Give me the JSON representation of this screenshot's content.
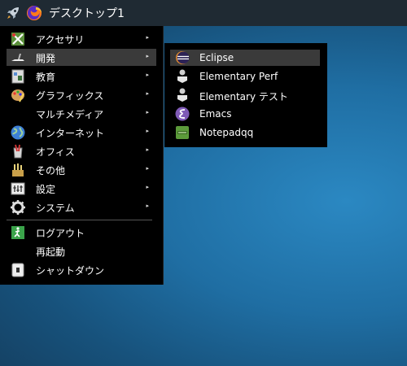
{
  "taskbar": {
    "title": "デスクトップ1",
    "icons": [
      "rocket-icon",
      "firefox-icon"
    ]
  },
  "menu": {
    "items": [
      {
        "label": "アクセサリ",
        "icon": "accessories-icon",
        "submenu": true
      },
      {
        "label": "開発",
        "icon": "development-icon",
        "submenu": true,
        "active": true
      },
      {
        "label": "教育",
        "icon": "education-icon",
        "submenu": true
      },
      {
        "label": "グラフィックス",
        "icon": "graphics-icon",
        "submenu": true
      },
      {
        "label": "マルチメディア",
        "icon": "",
        "submenu": true
      },
      {
        "label": "インターネット",
        "icon": "internet-icon",
        "submenu": true
      },
      {
        "label": "オフィス",
        "icon": "office-icon",
        "submenu": true
      },
      {
        "label": "その他",
        "icon": "other-icon",
        "submenu": true
      },
      {
        "label": "設定",
        "icon": "settings-icon",
        "submenu": true
      },
      {
        "label": "システム",
        "icon": "system-gear-icon",
        "submenu": true
      },
      {
        "label": "ログアウト",
        "icon": "logout-icon",
        "submenu": false
      },
      {
        "label": "再起動",
        "icon": "",
        "submenu": false
      },
      {
        "label": "シャットダウン",
        "icon": "shutdown-icon",
        "submenu": false
      }
    ],
    "arrow": "▸"
  },
  "submenu": {
    "items": [
      {
        "label": "Eclipse",
        "icon": "eclipse-icon",
        "active": true
      },
      {
        "label": "Elementary Perf",
        "icon": "elementary-perf-icon"
      },
      {
        "label": "Elementary テスト",
        "icon": "elementary-test-icon"
      },
      {
        "label": "Emacs",
        "icon": "emacs-icon"
      },
      {
        "label": "Notepadqq",
        "icon": "notepadqq-icon"
      }
    ]
  },
  "colors": {
    "menu_bg": "#000000",
    "highlight": "#3a3a3a",
    "taskbar": "#1f2a33",
    "desktop": "#1f6ea3"
  }
}
